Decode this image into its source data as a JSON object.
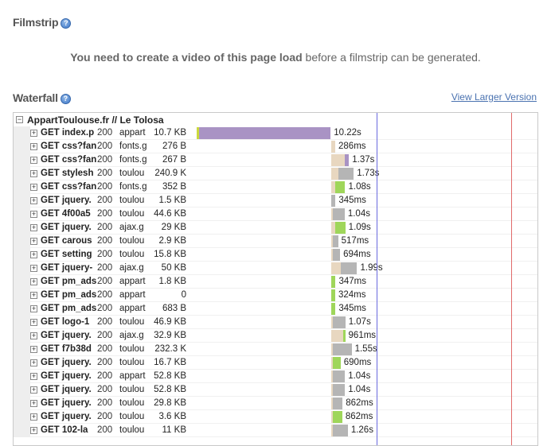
{
  "filmstrip": {
    "title": "Filmstrip",
    "message_bold": "You need to create a video of this page load",
    "message_rest": " before a filmstrip can be generated."
  },
  "waterfall": {
    "title": "Waterfall",
    "larger_link": "View Larger Version",
    "page_label": "AppartToulouse.fr // Le Tolosa",
    "colors": {
      "html": "#a993c4",
      "css": "#cbd93c",
      "js": "#b5b5b5",
      "blocking": "#e8d7c0",
      "light_green": "#9fd65a",
      "dom_line": "#6a6adf",
      "onload_line": "#e06a6a"
    },
    "requests": [
      {
        "name": "GET index.p",
        "status": "200",
        "host": "appart",
        "size": "10.7 KB",
        "time": "10.22s",
        "start": 0.0,
        "wait": 0.0,
        "dl": 10.22,
        "type": "html"
      },
      {
        "name": "GET css?fan",
        "status": "200",
        "host": "fonts.g",
        "size": "276 B",
        "time": "286ms",
        "start": 10.25,
        "wait": 0.08,
        "dl": 0.2,
        "type": "blocking"
      },
      {
        "name": "GET css?fan",
        "status": "200",
        "host": "fonts.g",
        "size": "267 B",
        "time": "1.37s",
        "start": 10.25,
        "wait": 1.05,
        "dl": 0.32,
        "type": "html"
      },
      {
        "name": "GET stylesh",
        "status": "200",
        "host": "toulou",
        "size": "240.9 K",
        "time": "1.73s",
        "start": 10.25,
        "wait": 0.55,
        "dl": 1.18,
        "type": "js"
      },
      {
        "name": "GET css?fan",
        "status": "200",
        "host": "fonts.g",
        "size": "352 B",
        "time": "1.08s",
        "start": 10.25,
        "wait": 0.35,
        "dl": 0.73,
        "type": "light_green"
      },
      {
        "name": "GET jquery.",
        "status": "200",
        "host": "toulou",
        "size": "1.5 KB",
        "time": "345ms",
        "start": 10.25,
        "wait": 0.0,
        "dl": 0.34,
        "type": "js"
      },
      {
        "name": "GET 4f00a5",
        "status": "200",
        "host": "toulou",
        "size": "44.6 KB",
        "time": "1.04s",
        "start": 10.25,
        "wait": 0.15,
        "dl": 0.89,
        "type": "js"
      },
      {
        "name": "GET jquery.",
        "status": "200",
        "host": "ajax.g",
        "size": "29 KB",
        "time": "1.09s",
        "start": 10.25,
        "wait": 0.35,
        "dl": 0.74,
        "type": "light_green"
      },
      {
        "name": "GET carous",
        "status": "200",
        "host": "toulou",
        "size": "2.9 KB",
        "time": "517ms",
        "start": 10.25,
        "wait": 0.1,
        "dl": 0.42,
        "type": "js"
      },
      {
        "name": "GET setting",
        "status": "200",
        "host": "toulou",
        "size": "15.8 KB",
        "time": "694ms",
        "start": 10.25,
        "wait": 0.15,
        "dl": 0.54,
        "type": "js"
      },
      {
        "name": "GET jquery-",
        "status": "200",
        "host": "ajax.g",
        "size": "50 KB",
        "time": "1.99s",
        "start": 10.25,
        "wait": 0.75,
        "dl": 1.24,
        "type": "js"
      },
      {
        "name": "GET pm_ads",
        "status": "200",
        "host": "appart",
        "size": "1.8 KB",
        "time": "347ms",
        "start": 10.25,
        "wait": 0.0,
        "dl": 0.35,
        "type": "light_green"
      },
      {
        "name": "GET pm_ads",
        "status": "200",
        "host": "appart",
        "size": "0",
        "time": "324ms",
        "start": 10.25,
        "wait": 0.0,
        "dl": 0.32,
        "type": "light_green"
      },
      {
        "name": "GET pm_ads",
        "status": "200",
        "host": "appart",
        "size": "683 B",
        "time": "345ms",
        "start": 10.25,
        "wait": 0.0,
        "dl": 0.34,
        "type": "light_green"
      },
      {
        "name": "GET logo-1",
        "status": "200",
        "host": "toulou",
        "size": "46.9 KB",
        "time": "1.07s",
        "start": 10.25,
        "wait": 0.1,
        "dl": 0.97,
        "type": "js"
      },
      {
        "name": "GET jquery.",
        "status": "200",
        "host": "ajax.g",
        "size": "32.9 KB",
        "time": "961ms",
        "start": 10.25,
        "wait": 0.9,
        "dl": 0.06,
        "type": "light_green"
      },
      {
        "name": "GET f7b38d",
        "status": "200",
        "host": "toulou",
        "size": "232.3 K",
        "time": "1.55s",
        "start": 10.25,
        "wait": 0.1,
        "dl": 1.45,
        "type": "js"
      },
      {
        "name": "GET jquery.",
        "status": "200",
        "host": "toulou",
        "size": "16.7 KB",
        "time": "690ms",
        "start": 10.25,
        "wait": 0.08,
        "dl": 0.61,
        "type": "light_green"
      },
      {
        "name": "GET jquery.",
        "status": "200",
        "host": "appart",
        "size": "52.8 KB",
        "time": "1.04s",
        "start": 10.25,
        "wait": 0.1,
        "dl": 0.94,
        "type": "js"
      },
      {
        "name": "GET jquery.",
        "status": "200",
        "host": "toulou",
        "size": "52.8 KB",
        "time": "1.04s",
        "start": 10.25,
        "wait": 0.1,
        "dl": 0.94,
        "type": "js"
      },
      {
        "name": "GET jquery.",
        "status": "200",
        "host": "toulou",
        "size": "29.8 KB",
        "time": "862ms",
        "start": 10.25,
        "wait": 0.1,
        "dl": 0.76,
        "type": "js"
      },
      {
        "name": "GET jquery.",
        "status": "200",
        "host": "toulou",
        "size": "3.6 KB",
        "time": "862ms",
        "start": 10.25,
        "wait": 0.15,
        "dl": 0.71,
        "type": "light_green"
      },
      {
        "name": "GET 102-la",
        "status": "200",
        "host": "toulou",
        "size": "11 KB",
        "time": "1.26s",
        "start": 10.25,
        "wait": 0.1,
        "dl": 1.16,
        "type": "js"
      }
    ],
    "dom_content_loaded_s": 13.7,
    "onload_s": 24.0,
    "timeline_max_s": 26.0
  }
}
